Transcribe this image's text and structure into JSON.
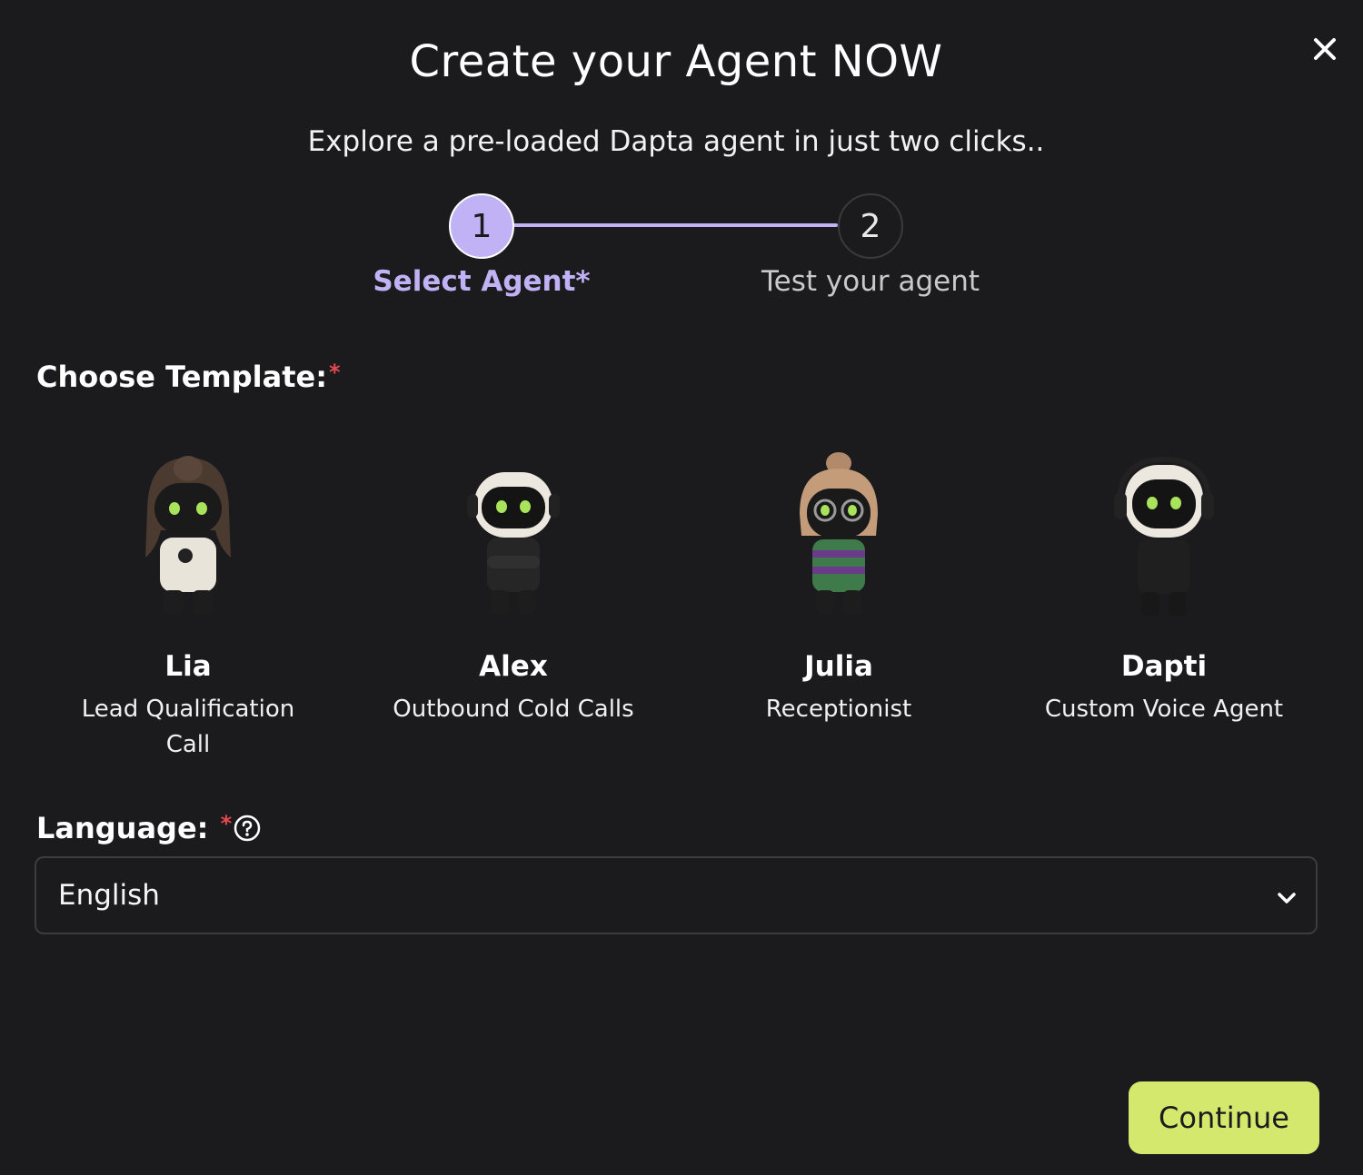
{
  "header": {
    "title": "Create your Agent NOW",
    "subtitle": "Explore a pre-loaded Dapta agent in just two clicks..",
    "close_icon": "close-icon"
  },
  "stepper": {
    "steps": [
      {
        "number": "1",
        "label": "Select Agent*",
        "active": true
      },
      {
        "number": "2",
        "label": "Test your agent",
        "active": false
      }
    ],
    "active_color": "#c1b2f6"
  },
  "template": {
    "label": "Choose Template:",
    "required_mark": "*",
    "agents": [
      {
        "name": "Lia",
        "description": "Lead Qualification Call",
        "icon": "lia-avatar"
      },
      {
        "name": "Alex",
        "description": "Outbound Cold Calls",
        "icon": "alex-avatar"
      },
      {
        "name": "Julia",
        "description": "Receptionist",
        "icon": "julia-avatar"
      },
      {
        "name": "Dapti",
        "description": "Custom Voice Agent",
        "icon": "dapti-avatar"
      }
    ]
  },
  "language": {
    "label": "Language:",
    "required_mark": "*",
    "help_icon": "question-circle-icon",
    "selected": "English",
    "chevron_icon": "chevron-down-icon"
  },
  "footer": {
    "continue_label": "Continue",
    "button_color": "#d4e86d"
  }
}
